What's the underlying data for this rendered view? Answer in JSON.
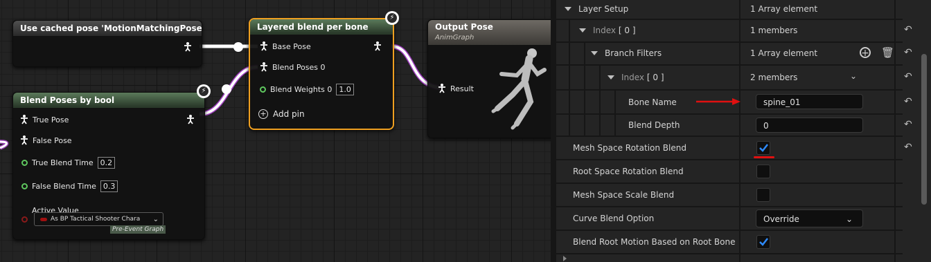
{
  "graph": {
    "cached_node": {
      "title": "Use cached pose 'MotionMatchingPose'"
    },
    "blend_bool_node": {
      "title": "Blend Poses by bool",
      "pins": {
        "true_pose": "True Pose",
        "false_pose": "False Pose",
        "true_blend_time": "True Blend Time",
        "true_blend_time_value": "0.2",
        "false_blend_time": "False Blend Time",
        "false_blend_time_value": "0.3",
        "active_value": "Active Value",
        "active_value_select": "As BP Tactical Shooter Chara",
        "pre_event_graph": "Pre-Event Graph"
      }
    },
    "layered_node": {
      "title": "Layered blend per bone",
      "pins": {
        "base_pose": "Base Pose",
        "blend_poses": "Blend Poses 0",
        "blend_weights": "Blend Weights 0",
        "blend_weights_value": "1.0",
        "add_pin": "Add pin"
      }
    },
    "output_node": {
      "title": "Output Pose",
      "subtitle": "AnimGraph",
      "result": "Result"
    }
  },
  "details": {
    "rows": {
      "layer_setup": {
        "label": "Layer Setup",
        "value": "1 Array element"
      },
      "index0": {
        "label": "Index",
        "index": "[ 0 ]",
        "value": "1 members"
      },
      "branch_filters": {
        "label": "Branch Filters",
        "value": "1 Array element"
      },
      "index0_inner": {
        "label": "Index",
        "index": "[ 0 ]",
        "value": "2 members"
      },
      "bone_name": {
        "label": "Bone Name",
        "value": "spine_01"
      },
      "blend_depth": {
        "label": "Blend Depth",
        "value": "0"
      },
      "mesh_space_rotation_blend": {
        "label": "Mesh Space Rotation Blend",
        "checked": true
      },
      "root_space_rotation_blend": {
        "label": "Root Space Rotation Blend",
        "checked": false
      },
      "mesh_space_scale_blend": {
        "label": "Mesh Space Scale Blend",
        "checked": false
      },
      "curve_blend_option": {
        "label": "Curve Blend Option",
        "value": "Override"
      },
      "blend_root_motion": {
        "label": "Blend Root Motion Based on Root Bone",
        "checked": true
      }
    }
  },
  "colors": {
    "annotation_red": "#e01010",
    "check_blue": "#2e8bff",
    "selected_orange": "#f0a020",
    "wire_white": "#ffffff",
    "wire_purple": "#a040c0",
    "exec_green": "#5fc85f"
  }
}
